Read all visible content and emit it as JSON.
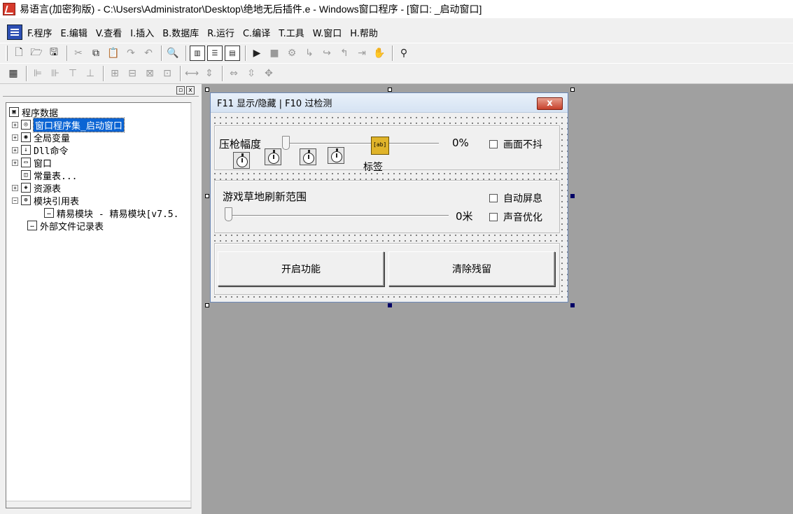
{
  "window": {
    "title": "易语言(加密狗版) - C:\\Users\\Administrator\\Desktop\\绝地无后插件.e - Windows窗口程序 - [窗口: _启动窗口]"
  },
  "menu": [
    "F.程序",
    "E.编辑",
    "V.查看",
    "I.插入",
    "B.数据库",
    "R.运行",
    "C.编译",
    "T.工具",
    "W.窗口",
    "H.帮助"
  ],
  "panel": {
    "minimize": "▫",
    "close": "x"
  },
  "tree": {
    "root": "程序数据",
    "items": [
      "窗口程序集_启动窗口",
      "全局变量",
      "Dll命令",
      "窗口",
      "常量表...",
      "资源表",
      "模块引用表",
      "精易模块 - 精易模块[v7.5.",
      "外部文件记录表"
    ]
  },
  "form": {
    "title": "F11 显示/隐藏 | F10 过检测",
    "close_label": "x",
    "recoil_label": "压枪幅度",
    "recoil_value": "0%",
    "anti_shake": "画面不抖",
    "label_text": "标签",
    "grass_label": "游戏草地刷新范围",
    "grass_value": "0米",
    "auto_screen": "自动屏息",
    "sound_opt": "声音优化",
    "start_button": "开启功能",
    "clear_button": "清除残留",
    "recoil_level": 0,
    "grass_level": 0
  }
}
